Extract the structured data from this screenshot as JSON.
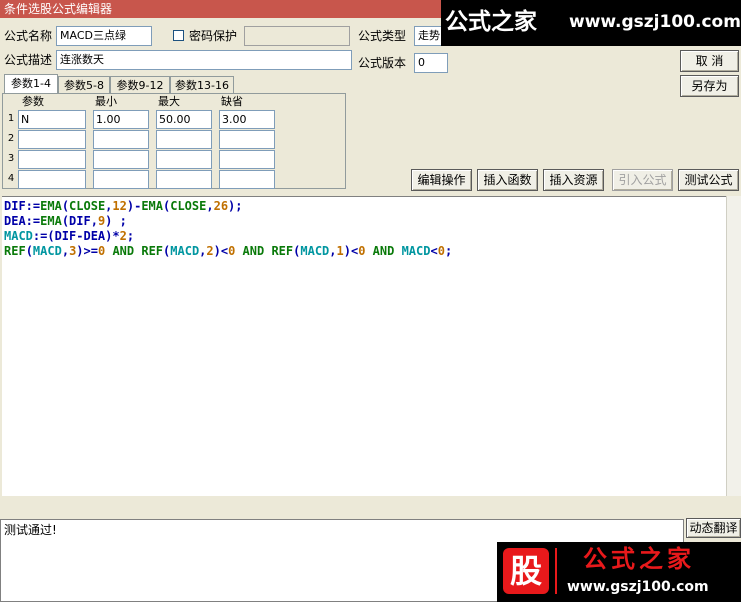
{
  "window": {
    "title": "条件选股公式编辑器"
  },
  "form": {
    "name_label": "公式名称",
    "name_value": "MACD三点绿",
    "password_label": "密码保护",
    "password_checked": false,
    "desc_label": "公式描述",
    "desc_value": "连涨数天",
    "type_label": "公式类型",
    "type_value": "走势",
    "version_label": "公式版本",
    "version_value": "0"
  },
  "buttons": {
    "cancel": "取 消",
    "save_as": "另存为",
    "edit_ops": "编辑操作",
    "insert_func": "插入函数",
    "insert_res": "插入资源",
    "import_formula": "引入公式",
    "test_formula": "测试公式",
    "dynamic_translate": "动态翻译"
  },
  "tabs": [
    "参数1-4",
    "参数5-8",
    "参数9-12",
    "参数13-16"
  ],
  "params": {
    "headers": [
      "参数",
      "最小",
      "最大",
      "缺省"
    ],
    "rows": [
      {
        "num": "1",
        "name": "N",
        "min": "1.00",
        "max": "50.00",
        "default": "3.00"
      },
      {
        "num": "2",
        "name": "",
        "min": "",
        "max": "",
        "default": ""
      },
      {
        "num": "3",
        "name": "",
        "min": "",
        "max": "",
        "default": ""
      },
      {
        "num": "4",
        "name": "",
        "min": "",
        "max": "",
        "default": ""
      }
    ]
  },
  "code": {
    "lines": [
      [
        {
          "t": "DIF:=",
          "c": "#0000a8"
        },
        {
          "t": "EMA",
          "c": "#0a7a0a"
        },
        {
          "t": "(",
          "c": "#0000a8"
        },
        {
          "t": "CLOSE",
          "c": "#0a7a0a"
        },
        {
          "t": ",",
          "c": "#0000a8"
        },
        {
          "t": "12",
          "c": "#c07000"
        },
        {
          "t": ")-",
          "c": "#0000a8"
        },
        {
          "t": "EMA",
          "c": "#0a7a0a"
        },
        {
          "t": "(",
          "c": "#0000a8"
        },
        {
          "t": "CLOSE",
          "c": "#0a7a0a"
        },
        {
          "t": ",",
          "c": "#0000a8"
        },
        {
          "t": "26",
          "c": "#c07000"
        },
        {
          "t": ");",
          "c": "#0000a8"
        }
      ],
      [
        {
          "t": "DEA:=",
          "c": "#0000a8"
        },
        {
          "t": "EMA",
          "c": "#0a7a0a"
        },
        {
          "t": "(DIF,",
          "c": "#0000a8"
        },
        {
          "t": "9",
          "c": "#c07000"
        },
        {
          "t": ") ;",
          "c": "#0000a8"
        }
      ],
      [
        {
          "t": "MACD",
          "c": "#0096a0"
        },
        {
          "t": ":=(DIF-DEA)*",
          "c": "#0000a8"
        },
        {
          "t": "2",
          "c": "#c07000"
        },
        {
          "t": ";",
          "c": "#0000a8"
        }
      ],
      [
        {
          "t": "REF",
          "c": "#0a7a0a"
        },
        {
          "t": "(",
          "c": "#0000a8"
        },
        {
          "t": "MACD",
          "c": "#0096a0"
        },
        {
          "t": ",",
          "c": "#0000a8"
        },
        {
          "t": "3",
          "c": "#c07000"
        },
        {
          "t": ")>=",
          "c": "#0000a8"
        },
        {
          "t": "0",
          "c": "#c07000"
        },
        {
          "t": " AND ",
          "c": "#0a7a0a"
        },
        {
          "t": "REF",
          "c": "#0a7a0a"
        },
        {
          "t": "(",
          "c": "#0000a8"
        },
        {
          "t": "MACD",
          "c": "#0096a0"
        },
        {
          "t": ",",
          "c": "#0000a8"
        },
        {
          "t": "2",
          "c": "#c07000"
        },
        {
          "t": ")<",
          "c": "#0000a8"
        },
        {
          "t": "0",
          "c": "#c07000"
        },
        {
          "t": " AND ",
          "c": "#0a7a0a"
        },
        {
          "t": "REF",
          "c": "#0a7a0a"
        },
        {
          "t": "(",
          "c": "#0000a8"
        },
        {
          "t": "MACD",
          "c": "#0096a0"
        },
        {
          "t": ",",
          "c": "#0000a8"
        },
        {
          "t": "1",
          "c": "#c07000"
        },
        {
          "t": ")<",
          "c": "#0000a8"
        },
        {
          "t": "0",
          "c": "#c07000"
        },
        {
          "t": " AND ",
          "c": "#0a7a0a"
        },
        {
          "t": "MACD",
          "c": "#0096a0"
        },
        {
          "t": "<",
          "c": "#0000a8"
        },
        {
          "t": "0",
          "c": "#c07000"
        },
        {
          "t": ";",
          "c": "#0000a8"
        }
      ]
    ]
  },
  "status": {
    "text": "测试通过!"
  },
  "watermark": {
    "top_name": "公式之家",
    "top_url": "www.gszj100.com",
    "bottom_badge": "股",
    "bottom_name": "公式之家",
    "bottom_url": "www.gszj100.com"
  },
  "colors": {
    "titlebar": "#c8564c",
    "accent_red": "#e8191b"
  }
}
